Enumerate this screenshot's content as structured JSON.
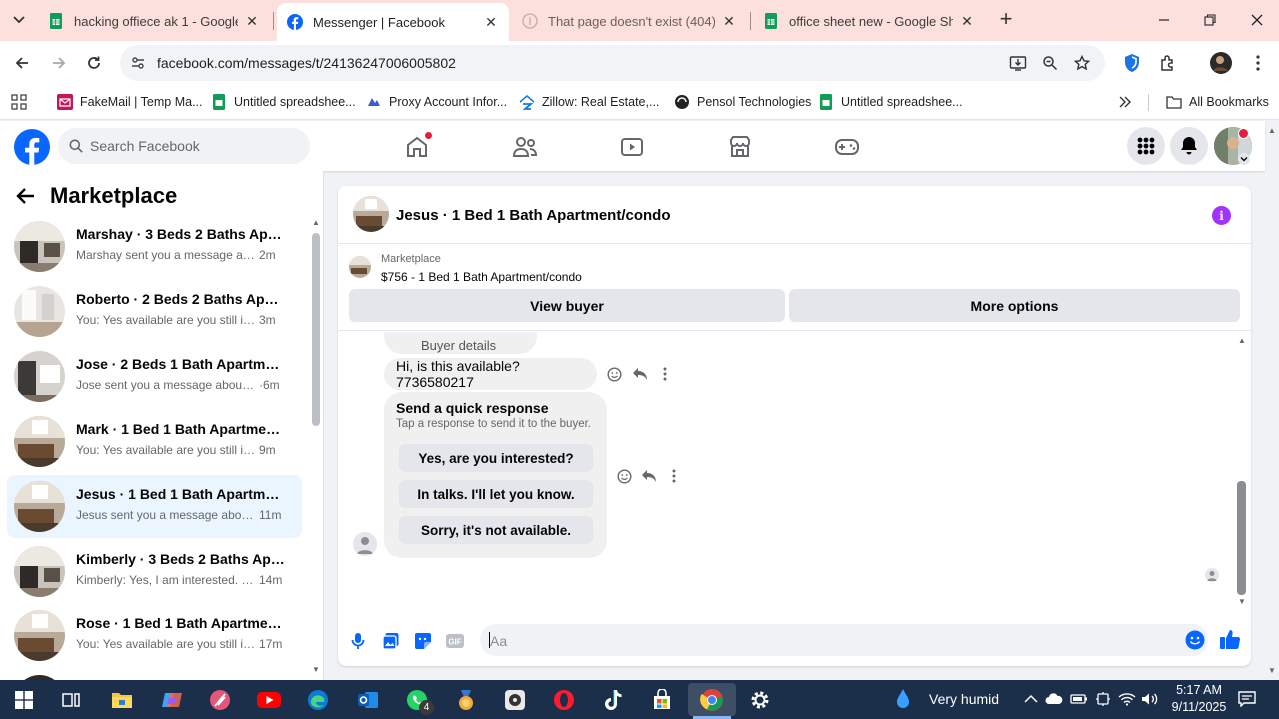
{
  "browser": {
    "tabs": [
      {
        "title": "hacking offiece ak 1 - Google D",
        "icon": "sheets-icon"
      },
      {
        "title": "Messenger | Facebook",
        "icon": "facebook-icon"
      },
      {
        "title": "That page doesn't exist (404) - I",
        "icon": "pinterest-icon"
      },
      {
        "title": "office sheet new - Google Shee",
        "icon": "sheets-icon"
      }
    ],
    "url": "facebook.com/messages/t/24136247006005802",
    "bookmarks": [
      {
        "label": "FakeMail | Temp Ma...",
        "icon": "fakemail-icon"
      },
      {
        "label": "Untitled spreadshee...",
        "icon": "sheets-icon"
      },
      {
        "label": "Proxy Account Infor...",
        "icon": "proxy-icon"
      },
      {
        "label": "Zillow: Real Estate,...",
        "icon": "zillow-icon"
      },
      {
        "label": "Pensol Technologies",
        "icon": "pensol-icon"
      },
      {
        "label": "Untitled spreadshee...",
        "icon": "sheets-icon"
      }
    ],
    "all_bookmarks": "All Bookmarks"
  },
  "facebook": {
    "search_placeholder": "Search Facebook"
  },
  "sidebar": {
    "title": "Marketplace",
    "chats": [
      {
        "name": "Marshay · 3 Beds 2 Baths Apart...",
        "preview": "Marshay sent you a message abou...",
        "time": "2m"
      },
      {
        "name": "Roberto · 2 Beds 2 Baths Apart...",
        "preview": "You: Yes available are you still inter...",
        "time": "3m"
      },
      {
        "name": "Jose · 2 Beds 1 Bath Apartment/...",
        "preview": "Jose sent you a message about yo...",
        "time": "·6m"
      },
      {
        "name": "Mark · 1 Bed 1 Bath Apartment/...",
        "preview": "You: Yes available are you still inter...",
        "time": "9m"
      },
      {
        "name": "Jesus · 1 Bed 1 Bath Apartment/...",
        "preview": "Jesus sent you a message about ...",
        "time": "11m"
      },
      {
        "name": "Kimberly · 3 Beds 2 Baths Apart...",
        "preview": "Kimberly: Yes, I am interested. M...",
        "time": "14m"
      },
      {
        "name": "Rose · 1 Bed 1 Bath Apartment/c...",
        "preview": "You: Yes available are you still int...",
        "time": "17m"
      }
    ]
  },
  "conversation": {
    "title": "Jesus · 1 Bed 1 Bath Apartment/condo",
    "marketplace_label": "Marketplace",
    "listing": "$756 - 1 Bed 1 Bath Apartment/condo",
    "view_buyer": "View buyer",
    "more_options": "More options",
    "cut_message": "Buyer details",
    "message": "Hi, is this available? 7736580217",
    "quick_title": "Send a quick response",
    "quick_subtitle": "Tap a response to send it to the buyer.",
    "quick_responses": [
      "Yes, are you interested?",
      "In talks. I'll let you know.",
      "Sorry, it's not available."
    ],
    "input_placeholder": "Aa"
  },
  "taskbar": {
    "whatsapp_badge": "4",
    "weather": "Very humid",
    "time": "5:17 AM",
    "date": "9/11/2025"
  },
  "colors": {
    "messenger_blue": "#0866ff",
    "info_purple": "#a033ff",
    "tab_bar": "#fbe0dd",
    "taskbar": "#1c2f4a"
  }
}
